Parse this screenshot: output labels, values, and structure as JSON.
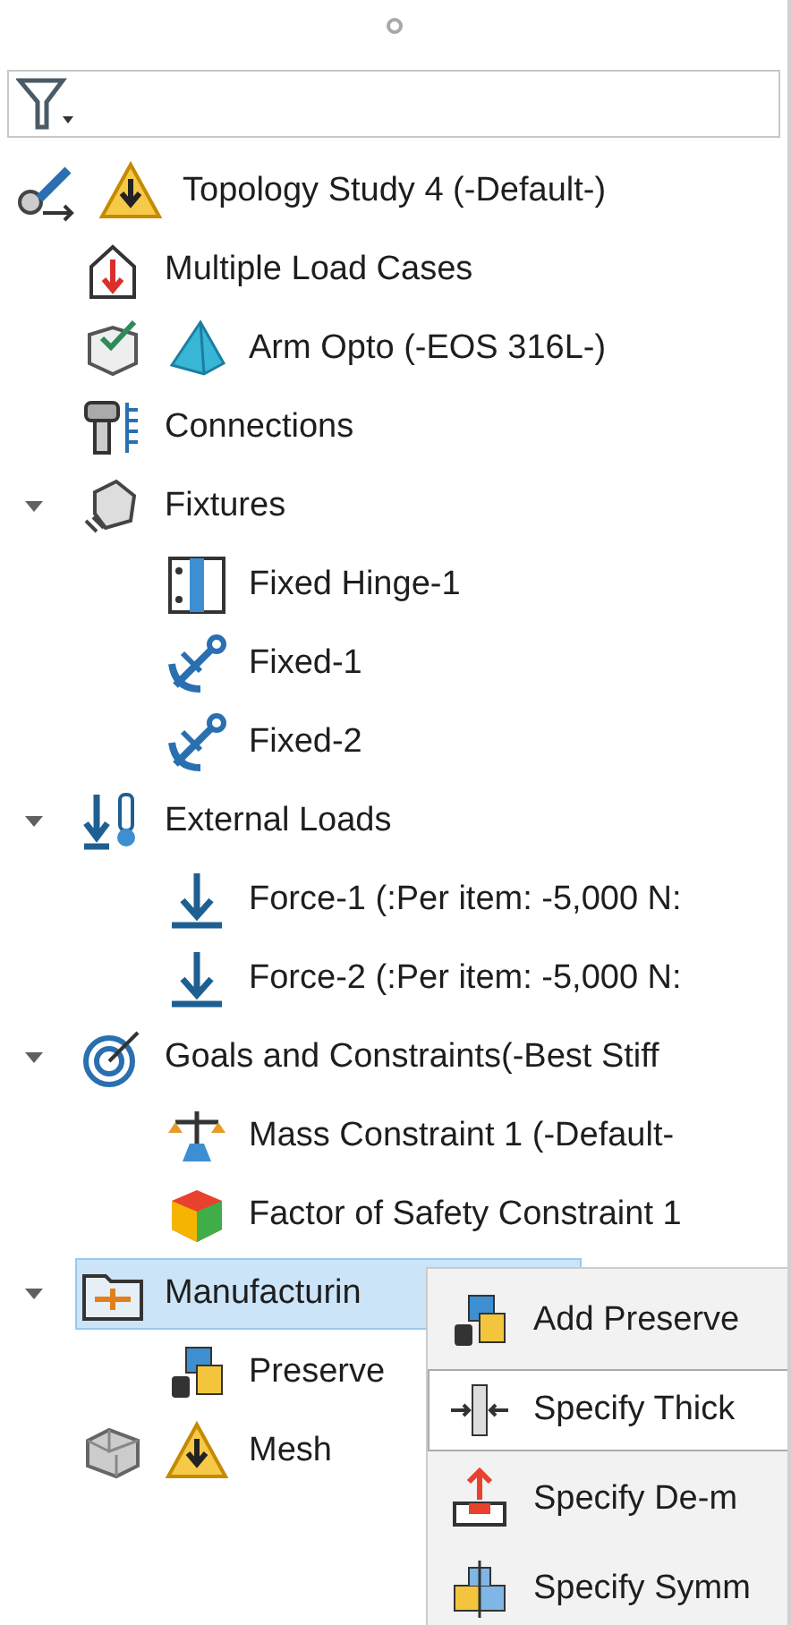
{
  "tree": {
    "label": "Topology Study 4 (-Default-)",
    "kind": "study",
    "warning": true,
    "selected": false,
    "children": [
      {
        "label": "Multiple Load Cases",
        "kind": "load-cases",
        "selected": false
      },
      {
        "label": "Arm Opto (-EOS 316L-)",
        "kind": "material",
        "selected": false
      },
      {
        "label": "Connections",
        "kind": "connections",
        "selected": false
      },
      {
        "label": "Fixtures",
        "kind": "fixtures",
        "selected": false,
        "expanded": true,
        "children": [
          {
            "label": "Fixed Hinge-1",
            "kind": "hinge",
            "selected": false
          },
          {
            "label": "Fixed-1",
            "kind": "fixed",
            "selected": false
          },
          {
            "label": "Fixed-2",
            "kind": "fixed",
            "selected": false
          }
        ]
      },
      {
        "label": "External Loads",
        "kind": "loads",
        "selected": false,
        "expanded": true,
        "children": [
          {
            "label": "Force-1 (:Per item: -5,000 N:",
            "kind": "force",
            "selected": false
          },
          {
            "label": "Force-2 (:Per item: -5,000 N:",
            "kind": "force",
            "selected": false
          }
        ]
      },
      {
        "label": "Goals and Constraints(-Best Stiff",
        "kind": "goals",
        "selected": false,
        "expanded": true,
        "children": [
          {
            "label": "Mass Constraint 1 (-Default-",
            "kind": "mass",
            "selected": false
          },
          {
            "label": "Factor of Safety Constraint 1",
            "kind": "safety",
            "selected": false
          }
        ]
      },
      {
        "label": "Manufacturin",
        "kind": "manufacturing",
        "selected": true,
        "expanded": true,
        "children": [
          {
            "label": "Preserve",
            "kind": "preserved",
            "selected": false
          }
        ]
      },
      {
        "label": "Mesh",
        "kind": "mesh",
        "warning": true,
        "selected": false
      }
    ]
  },
  "context_menu": {
    "items": [
      {
        "label": "Add Preserve",
        "kind": "preserved",
        "selected": false
      },
      {
        "label": "Specify Thick",
        "kind": "thickness",
        "selected": true
      },
      {
        "label": "Specify De-m",
        "kind": "demold",
        "selected": false
      },
      {
        "label": "Specify Symm",
        "kind": "symmetry",
        "selected": false
      }
    ]
  }
}
